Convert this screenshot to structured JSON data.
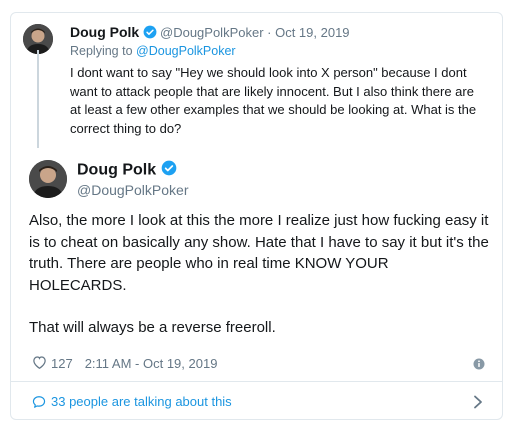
{
  "quoted_tweet": {
    "display_name": "Doug Polk",
    "handle": "@DougPolkPoker",
    "date": "Oct 19, 2019",
    "replying_prefix": "Replying to",
    "replying_to": "@DougPolkPoker",
    "text": "I dont want to say \"Hey we should look into X person\" because I dont want to attack people that are likely innocent. But I also think there are at least a few other examples that we should be looking at. What is the correct thing to do?"
  },
  "main_tweet": {
    "display_name": "Doug Polk",
    "handle": "@DougPolkPoker",
    "paragraph_1": "Also, the more I look at this the more I realize just how fucking easy it is to cheat on basically any show. Hate that I have to say it but it's the truth. There are people who in real time KNOW YOUR HOLECARDS.",
    "paragraph_2": "That will always be a reverse freeroll.",
    "likes": "127",
    "timestamp": "2:11 AM - Oct 19, 2019"
  },
  "conversation": {
    "label": "33 people are talking about this"
  },
  "icons": {
    "verified": "verified-badge-icon",
    "like": "heart-icon",
    "info": "info-icon",
    "conversation": "speech-bubble-icon",
    "chevron": "chevron-right-icon"
  },
  "colors": {
    "accent": "#1b95e0",
    "muted": "#657786",
    "text": "#14171a",
    "border": "#e1e8ed"
  }
}
